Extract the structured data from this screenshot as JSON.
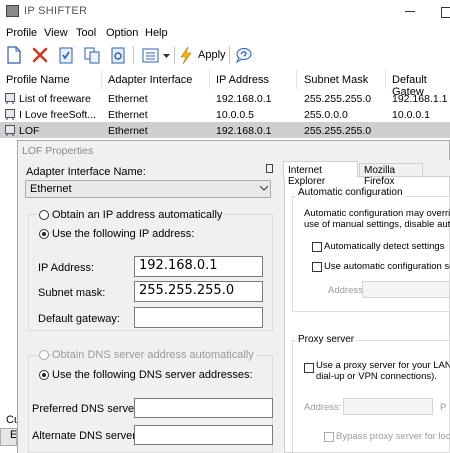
{
  "window": {
    "title": "IP SHIFTER"
  },
  "menu": [
    "Profile",
    "View",
    "Tool",
    "Option",
    "Help"
  ],
  "toolbar": {
    "apply_label": "Apply",
    "accent_red": "#d23a1c",
    "accent_blue": "#2a5fb0"
  },
  "list": {
    "columns": [
      "Profile Name",
      "Adapter Interface",
      "IP Address",
      "Subnet Mask",
      "Default Gatew"
    ],
    "rows": [
      [
        "List of freeware",
        "Ethernet",
        "192.168.0.1",
        "255.255.255.0",
        "192.168.1.1"
      ],
      [
        "I Love freeSoft...",
        "Ethernet",
        "10.0.0.5",
        "255.0.0.0",
        "10.0.0.1"
      ],
      [
        "LOF",
        "Ethernet",
        "192.168.0.1",
        "255.255.255.0",
        ""
      ]
    ],
    "selected_row": 2
  },
  "dialog": {
    "title": "LOF Properties",
    "adapter_label": "Adapter Interface Name:",
    "adapter_value": "Ethernet",
    "ip_auto_label": "Obtain an IP address automatically",
    "ip_manual_label": "Use the following IP address:",
    "ip_label": "IP  Address:",
    "ip_value": "192.168.0.1",
    "subnet_label": "Subnet mask:",
    "subnet_value": "255.255.255.0",
    "gateway_label": "Default gateway:",
    "gateway_value": "",
    "dns_auto_label": "Obtain DNS server address automatically",
    "dns_manual_label": "Use the following DNS server addresses:",
    "pref_dns_label": "Preferred DNS server:",
    "pref_dns_value": "",
    "alt_dns_label": "Alternate DNS server:",
    "alt_dns_value": "",
    "tabs": [
      "Internet Explorer",
      "Mozilla Firefox"
    ],
    "auto_config_title": "Automatic configuration",
    "auto_config_desc_1": "Automatic configuration may override",
    "auto_config_desc_2": "use of manual settings, disable autom",
    "auto_detect_label": "Automatically detect settings",
    "auto_script_label": "Use automatic configuration scrip",
    "address_label": "Address",
    "proxy_title": "Proxy server",
    "proxy_use_label_1": "Use a proxy server for your LAN (Th",
    "proxy_use_label_2": "dial-up or VPN connections).",
    "proxy_address_label": "Address:",
    "proxy_port_label": "P",
    "proxy_bypass_label": "Bypass proxy server for local"
  },
  "behind": {
    "text_1": "Cu",
    "text_2": "Et"
  }
}
